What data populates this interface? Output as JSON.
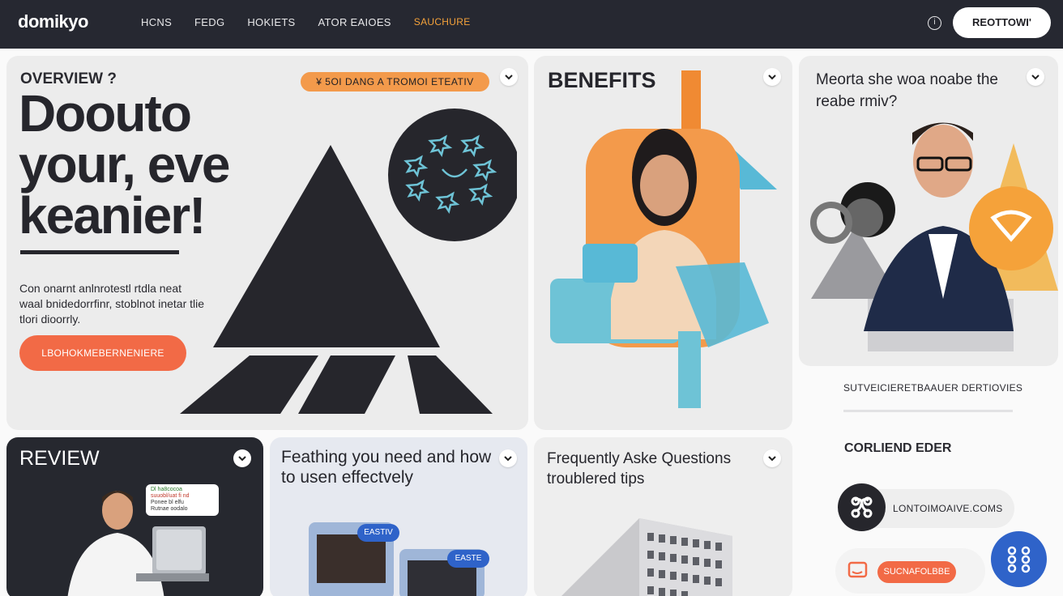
{
  "nav": {
    "logo": "domikyo",
    "links": [
      "HCNS",
      "FEDG",
      "HOKIETS",
      "ATOR EAIOES",
      "SAUCHURE"
    ],
    "help_icon": "help-circle-icon",
    "cta_label": "REOTTOWI'"
  },
  "overview": {
    "label": "OVERVIEW ?",
    "pill": "¥ 5OI DANG A TROMOI ETEATIV",
    "headline_lines": [
      "Doouto",
      "your, eve",
      "keanier!"
    ],
    "body": "Con onarnt anlnrotestl rtdla neat waal bnidedorrfinr, stoblnot inetar tlie tlori dioorrly.",
    "cta": "LBOHOKMEBERNENIERE"
  },
  "benefits": {
    "title": "BENEFITS"
  },
  "meorta": {
    "title": "Meorta she woa noabe the reabe rmiv?"
  },
  "side": {
    "heading": "SUTVEICIERETBAAUER DERTIOVIES",
    "subheading": "CORLIEND EDER",
    "contact_text": "LONTOIMOAIVE.COMS",
    "subscribe_label": "SUCNAFOLBBE"
  },
  "review": {
    "title": "REVIEW",
    "chat_lines": [
      "Dl ha8cocoa",
      "suuobl/uat fi nd",
      "Ponee bl elfu",
      "Rutnae oodalo"
    ]
  },
  "feathing": {
    "title": "Feathing you need and how to usen effectvely",
    "chip_a": "EASTIV",
    "chip_b": "EASTE"
  },
  "faq": {
    "title": "Frequently Aske Questions troublered tips"
  },
  "colors": {
    "dark": "#26262c",
    "orange": "#f39a4b",
    "coral": "#f26a46",
    "blue": "#2f63c9",
    "teal": "#58b9d6"
  }
}
